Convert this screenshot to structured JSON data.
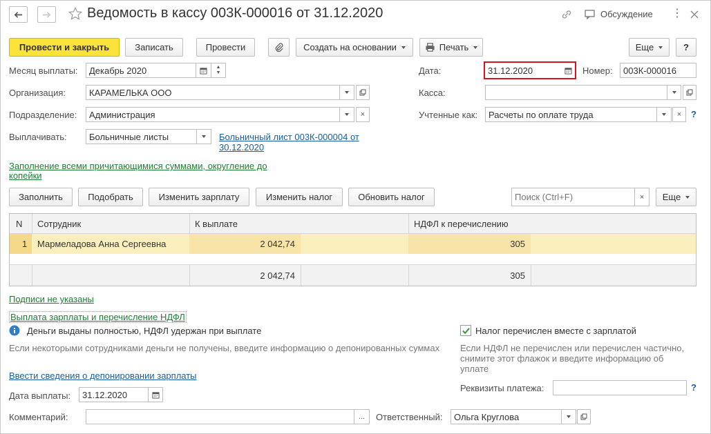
{
  "title": "Ведомость в кассу 003К-000016 от 31.12.2020",
  "header": {
    "discussion_label": "Обсуждение"
  },
  "toolbar": {
    "post_close": "Провести и закрыть",
    "save": "Записать",
    "post": "Провести",
    "create_based": "Создать на основании",
    "print": "Печать",
    "more": "Еще",
    "help": "?"
  },
  "form": {
    "month_label": "Месяц выплаты:",
    "month_value": "Декабрь 2020",
    "date_label": "Дата:",
    "date_value": "31.12.2020",
    "number_label": "Номер:",
    "number_value": "003К-000016",
    "org_label": "Организация:",
    "org_value": "КАРАМЕЛЬКА ООО",
    "cash_label": "Касса:",
    "cash_value": "",
    "dept_label": "Подразделение:",
    "dept_value": "Администрация",
    "accounted_label": "Учтенные как:",
    "accounted_value": "Расчеты по оплате труда",
    "pay_label": "Выплачивать:",
    "pay_value": "Больничные листы",
    "sick_link_line1": "Больничный лист 003К-000004 от",
    "sick_link_line2": "30.12.2020",
    "fill_link_line1": "Заполнение всеми причитающимися суммами, округление до",
    "fill_link_line2": "копейки"
  },
  "table_toolbar": {
    "fill": "Заполнить",
    "pick": "Подобрать",
    "change_salary": "Изменить зарплату",
    "change_tax": "Изменить налог",
    "update_tax": "Обновить налог",
    "search_placeholder": "Поиск (Ctrl+F)",
    "more": "Еще"
  },
  "table": {
    "columns": [
      "N",
      "Сотрудник",
      "К выплате",
      "НДФЛ к перечислению"
    ],
    "rows": [
      {
        "n": "1",
        "employee": "Мармеладова Анна Сергеевна",
        "amount": "2 042,74",
        "ndfl": "305"
      }
    ],
    "totals": {
      "amount": "2 042,74",
      "ndfl": "305"
    }
  },
  "bottom": {
    "signatures_link": "Подписи не указаны",
    "payment_link": "Выплата зарплаты и перечисление НДФЛ",
    "info_text": "Деньги выданы полностью, НДФЛ удержан при выплате",
    "hint_text": "Если некоторыми сотрудниками деньги не получены, введите информацию о депонированных суммах",
    "checkbox_label": "Налог перечислен вместе с зарплатой",
    "tax_hint_line1": "Если НДФЛ не перечислен или перечислен частично,",
    "tax_hint_line2": "снимите этот флажок и введите информацию об",
    "tax_hint_line3": "уплате",
    "deposit_link": "Ввести сведения о депонировании зарплаты",
    "pay_date_label": "Дата выплаты:",
    "pay_date_value": "31.12.2020",
    "payment_details_label": "Реквизиты платежа:",
    "payment_details_value": "",
    "comment_label": "Комментарий:",
    "comment_value": "",
    "responsible_label": "Ответственный:",
    "responsible_value": "Ольга Круглова",
    "ellipsis": "..."
  },
  "colors": {
    "accent_yellow": "#fbe33b",
    "link_blue": "#185d9c",
    "link_green": "#1e7e35",
    "row_highlight": "#fbefbe",
    "date_highlight": "#d9141c"
  }
}
